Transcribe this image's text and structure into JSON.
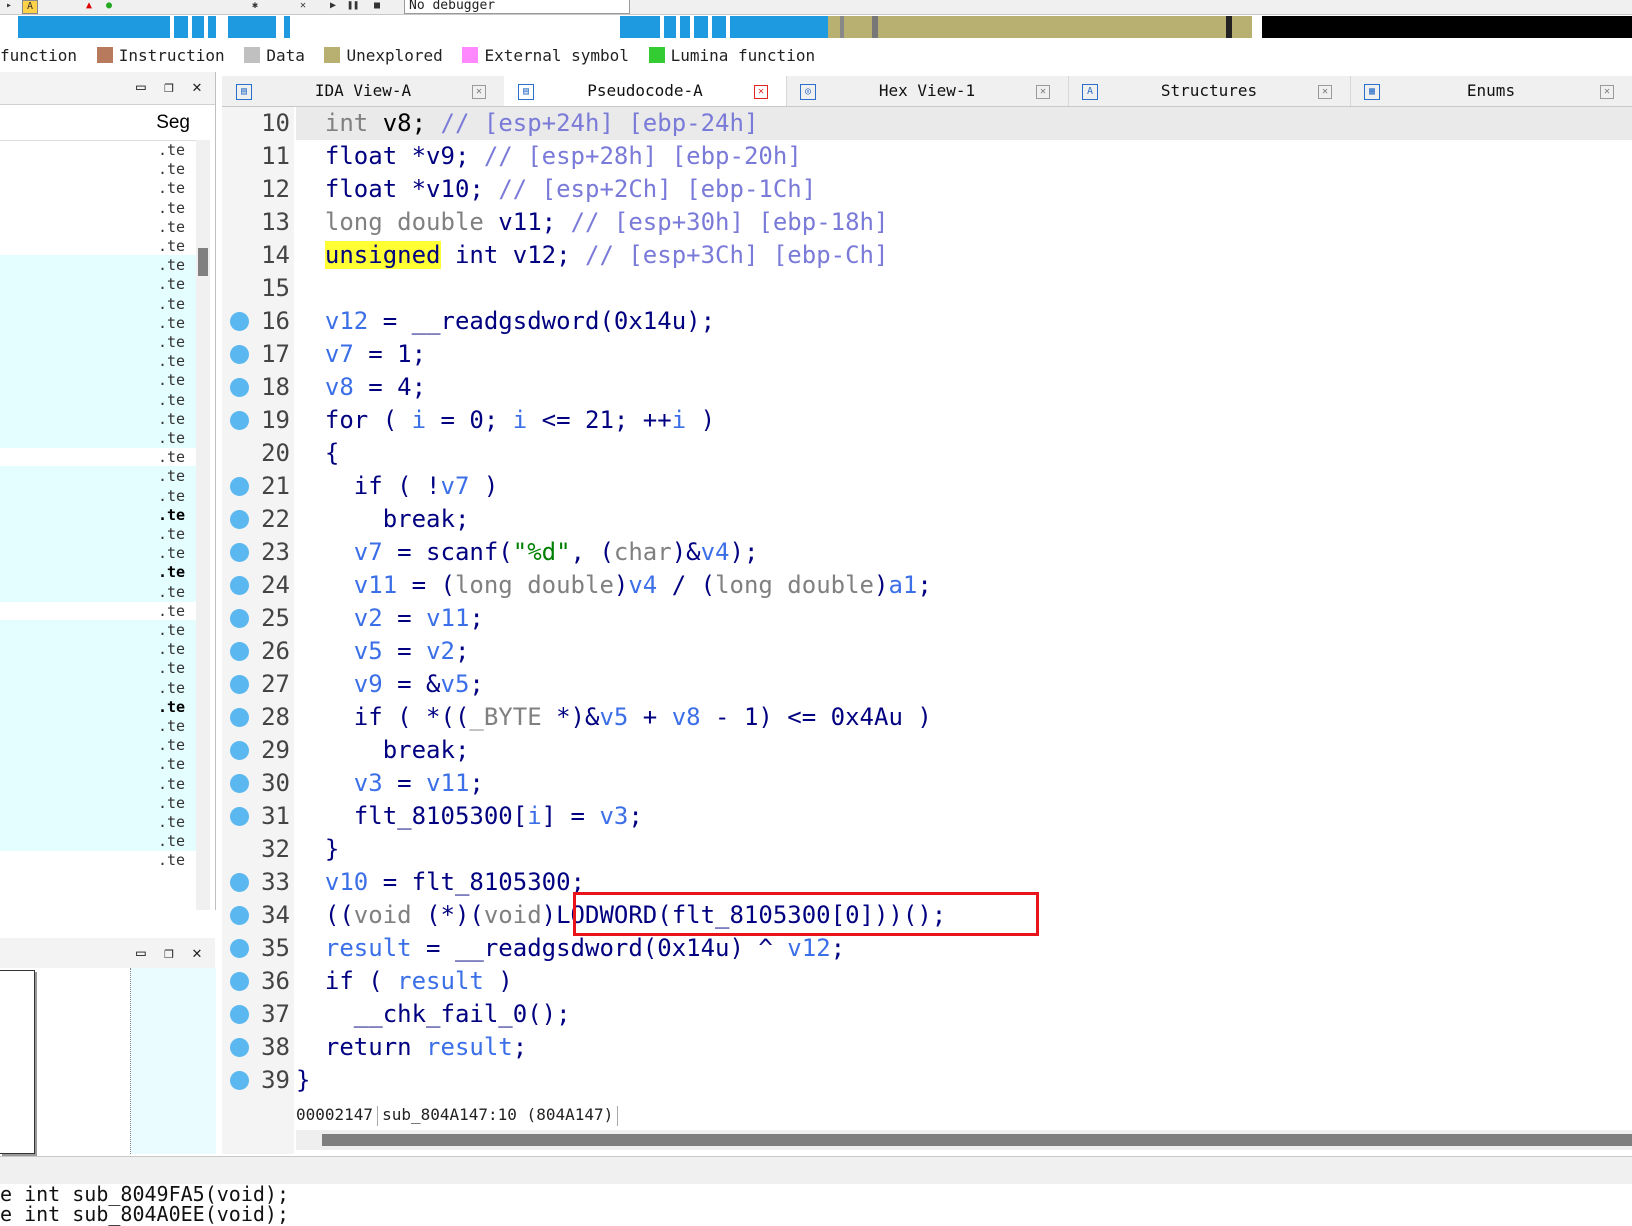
{
  "toolbar": {
    "debugger_select": "No debugger"
  },
  "legend": [
    {
      "label": "function",
      "color": ""
    },
    {
      "label": "Instruction",
      "color": "#b87a5c"
    },
    {
      "label": "Data",
      "color": "#c0c0c0"
    },
    {
      "label": "Unexplored",
      "color": "#b8b070"
    },
    {
      "label": "External symbol",
      "color": "#ff88ff"
    },
    {
      "label": "Lumina function",
      "color": "#33cc33"
    }
  ],
  "left_pane": {
    "segment_header": "Seg",
    "segment_value": ".te"
  },
  "tabs": [
    {
      "label": "IDA View-A",
      "icon": "ida-view-icon"
    },
    {
      "label": "Pseudocode-A",
      "icon": "pseudocode-icon"
    },
    {
      "label": "Hex View-1",
      "icon": "hex-icon"
    },
    {
      "label": "Structures",
      "icon": "structures-icon"
    },
    {
      "label": "Enums",
      "icon": "enums-icon"
    }
  ],
  "code": {
    "line_numbers": [
      "10",
      "11",
      "12",
      "13",
      "14",
      "15",
      "16",
      "17",
      "18",
      "19",
      "20",
      "21",
      "22",
      "23",
      "24",
      "25",
      "26",
      "27",
      "28",
      "29",
      "30",
      "31",
      "32",
      "33",
      "34",
      "35",
      "36",
      "37",
      "38",
      "39"
    ],
    "lines": [
      {
        "t": [
          [
            "  ",
            ""
          ],
          [
            "int",
            "ty"
          ],
          [
            " v8; ",
            ""
          ],
          [
            "// [esp+24h] [ebp-24h]",
            "cm2"
          ]
        ]
      },
      {
        "t": [
          [
            "  ",
            ""
          ],
          [
            "float",
            "kw"
          ],
          [
            " *v9; ",
            "kw"
          ],
          [
            "// [esp+28h] [ebp-20h]",
            "cm2"
          ]
        ]
      },
      {
        "t": [
          [
            "  ",
            ""
          ],
          [
            "float",
            "kw"
          ],
          [
            " *v10; ",
            "kw"
          ],
          [
            "// [esp+2Ch] [ebp-1Ch]",
            "cm2"
          ]
        ]
      },
      {
        "t": [
          [
            "  ",
            ""
          ],
          [
            "long double",
            "ty"
          ],
          [
            " v11; ",
            "kw"
          ],
          [
            "// [esp+30h] [ebp-18h]",
            "cm2"
          ]
        ]
      },
      {
        "t": [
          [
            "  ",
            ""
          ],
          [
            "unsigned",
            "hl"
          ],
          [
            " int v12; ",
            "kw"
          ],
          [
            "// [esp+3Ch] [ebp-Ch]",
            "cm2"
          ]
        ]
      },
      {
        "t": [
          [
            "",
            ""
          ]
        ]
      },
      {
        "t": [
          [
            "  ",
            ""
          ],
          [
            "v12",
            "vr"
          ],
          [
            " = __readgsdword(0x14u);",
            "kw"
          ]
        ]
      },
      {
        "t": [
          [
            "  ",
            ""
          ],
          [
            "v7",
            "vr"
          ],
          [
            " = 1;",
            "kw"
          ]
        ]
      },
      {
        "t": [
          [
            "  ",
            ""
          ],
          [
            "v8",
            "vr"
          ],
          [
            " = 4;",
            "kw"
          ]
        ]
      },
      {
        "t": [
          [
            "  for ( ",
            "kw"
          ],
          [
            "i",
            "vr"
          ],
          [
            " = 0; ",
            "kw"
          ],
          [
            "i",
            "vr"
          ],
          [
            " <= 21; ++",
            "kw"
          ],
          [
            "i",
            "vr"
          ],
          [
            " )",
            "kw"
          ]
        ]
      },
      {
        "t": [
          [
            "  {",
            "kw"
          ]
        ]
      },
      {
        "t": [
          [
            "    if ( !",
            "kw"
          ],
          [
            "v7",
            "vr"
          ],
          [
            " )",
            "kw"
          ]
        ]
      },
      {
        "t": [
          [
            "      break;",
            "kw"
          ]
        ]
      },
      {
        "t": [
          [
            "    ",
            ""
          ],
          [
            "v7",
            "vr"
          ],
          [
            " = scanf(",
            "kw"
          ],
          [
            "\"%d\"",
            "st"
          ],
          [
            ", (",
            "kw"
          ],
          [
            "char",
            "ty"
          ],
          [
            ")&",
            "kw"
          ],
          [
            "v4",
            "vr"
          ],
          [
            ");",
            "kw"
          ]
        ]
      },
      {
        "t": [
          [
            "    ",
            ""
          ],
          [
            "v11",
            "vr"
          ],
          [
            " = (",
            "kw"
          ],
          [
            "long double",
            "ty"
          ],
          [
            ")",
            "kw"
          ],
          [
            "v4",
            "vr"
          ],
          [
            " / (",
            "kw"
          ],
          [
            "long double",
            "ty"
          ],
          [
            ")",
            "kw"
          ],
          [
            "a1",
            "vr"
          ],
          [
            ";",
            "kw"
          ]
        ]
      },
      {
        "t": [
          [
            "    ",
            ""
          ],
          [
            "v2",
            "vr"
          ],
          [
            " = ",
            "kw"
          ],
          [
            "v11",
            "vr"
          ],
          [
            ";",
            "kw"
          ]
        ]
      },
      {
        "t": [
          [
            "    ",
            ""
          ],
          [
            "v5",
            "vr"
          ],
          [
            " = ",
            "kw"
          ],
          [
            "v2",
            "vr"
          ],
          [
            ";",
            "kw"
          ]
        ]
      },
      {
        "t": [
          [
            "    ",
            ""
          ],
          [
            "v9",
            "vr"
          ],
          [
            " = &",
            "kw"
          ],
          [
            "v5",
            "vr"
          ],
          [
            ";",
            "kw"
          ]
        ]
      },
      {
        "t": [
          [
            "    if ( *((",
            "kw"
          ],
          [
            "_BYTE",
            "ty"
          ],
          [
            " *)&",
            "kw"
          ],
          [
            "v5",
            "vr"
          ],
          [
            " + ",
            "kw"
          ],
          [
            "v8",
            "vr"
          ],
          [
            " - 1) <= 0x4Au )",
            "kw"
          ]
        ]
      },
      {
        "t": [
          [
            "      break;",
            "kw"
          ]
        ]
      },
      {
        "t": [
          [
            "    ",
            ""
          ],
          [
            "v3",
            "vr"
          ],
          [
            " = ",
            "kw"
          ],
          [
            "v11",
            "vr"
          ],
          [
            ";",
            "kw"
          ]
        ]
      },
      {
        "t": [
          [
            "    flt_8105300[",
            "kw"
          ],
          [
            "i",
            "vr"
          ],
          [
            "] = ",
            "kw"
          ],
          [
            "v3",
            "vr"
          ],
          [
            ";",
            "kw"
          ]
        ]
      },
      {
        "t": [
          [
            "  }",
            "kw"
          ]
        ]
      },
      {
        "t": [
          [
            "  ",
            ""
          ],
          [
            "v10",
            "vr"
          ],
          [
            " = flt_8105300;",
            "kw"
          ]
        ]
      },
      {
        "t": [
          [
            "  ((",
            "kw"
          ],
          [
            "void",
            "ty"
          ],
          [
            " (*)(",
            "kw"
          ],
          [
            "void",
            "ty"
          ],
          [
            ")",
            "kw"
          ],
          [
            "LODWORD(flt_8105300[0]))();",
            "kw"
          ]
        ]
      },
      {
        "t": [
          [
            "  ",
            ""
          ],
          [
            "result",
            "vr"
          ],
          [
            " = __readgsdword(0x14u) ^ ",
            "kw"
          ],
          [
            "v12",
            "vr"
          ],
          [
            ";",
            "kw"
          ]
        ]
      },
      {
        "t": [
          [
            "  if ( ",
            "kw"
          ],
          [
            "result",
            "vr"
          ],
          [
            " )",
            "kw"
          ]
        ]
      },
      {
        "t": [
          [
            "    __chk_fail_0();",
            "kw"
          ]
        ]
      },
      {
        "t": [
          [
            "  return ",
            "kw"
          ],
          [
            "result",
            "vr"
          ],
          [
            ";",
            "kw"
          ]
        ]
      },
      {
        "t": [
          [
            "}",
            "kw"
          ]
        ]
      }
    ],
    "breakpoint_lines": [
      "16",
      "17",
      "18",
      "19",
      "21",
      "22",
      "23",
      "24",
      "25",
      "26",
      "27",
      "28",
      "29",
      "30",
      "31",
      "33",
      "34",
      "35",
      "36",
      "37",
      "38",
      "39"
    ]
  },
  "status": {
    "offset": "00002147",
    "location": "sub_804A147:10 (804A147)"
  },
  "output": [
    "e int sub_8049FA5(void);",
    "e int sub_804A0EE(void);"
  ]
}
